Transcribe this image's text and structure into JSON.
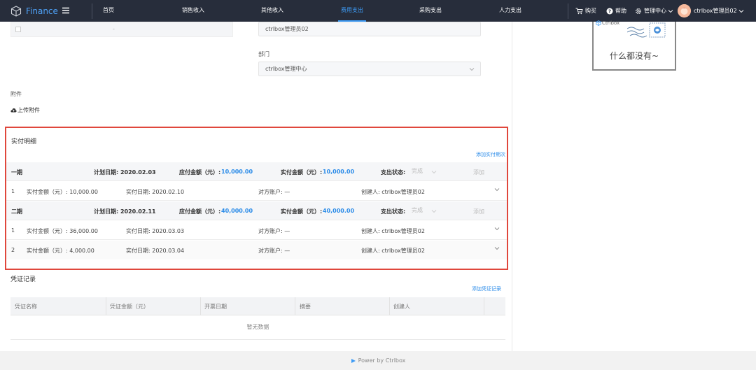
{
  "app": {
    "name": "Finance"
  },
  "nav": {
    "items": [
      {
        "label": "首页"
      },
      {
        "label": "销售收入"
      },
      {
        "label": "其他收入"
      },
      {
        "label": "费用支出"
      },
      {
        "label": "采购支出"
      },
      {
        "label": "人力支出"
      }
    ],
    "active_index": 3
  },
  "topright": {
    "buy": "购买",
    "help": "帮助",
    "admin": "管理中心",
    "user": "ctrlbox管理员02"
  },
  "form": {
    "top_grey_dash": "-",
    "applicant_value": "ctrlbox管理员02",
    "dept_label": "部门",
    "dept_value": "ctrlbox管理中心",
    "attachment_label": "附件",
    "upload_label": "上传附件"
  },
  "payment": {
    "title": "实付明细",
    "add_link": "添加实付期次",
    "periods": [
      {
        "name": "一期",
        "plan_date": "计划日期: 2020.02.03",
        "due_label": "应付金额（元）:",
        "due_value": "10,000.00",
        "paid_label": "实付金额（元）:",
        "paid_value": "10,000.00",
        "status_label": "支出状态:",
        "status_value": "完成",
        "add": "添加",
        "records": [
          {
            "idx": "1",
            "amount": "实付金额（元）: 10,000.00",
            "date": "实付日期: 2020.02.10",
            "account": "对方账户: —",
            "creator": "创建人: ctrlbox管理员02"
          }
        ]
      },
      {
        "name": "二期",
        "plan_date": "计划日期: 2020.02.11",
        "due_label": "应付金额（元）:",
        "due_value": "40,000.00",
        "paid_label": "实付金额（元）:",
        "paid_value": "40,000.00",
        "status_label": "支出状态:",
        "status_value": "完成",
        "add": "添加",
        "records": [
          {
            "idx": "1",
            "amount": "实付金额（元）: 36,000.00",
            "date": "实付日期: 2020.03.03",
            "account": "对方账户: —",
            "creator": "创建人: ctrlbox管理员02"
          },
          {
            "idx": "2",
            "amount": "实付金额（元）: 4,000.00",
            "date": "实付日期: 2020.03.04",
            "account": "对方账户: —",
            "creator": "创建人: ctrlbox管理员02"
          }
        ]
      }
    ]
  },
  "voucher": {
    "title": "凭证记录",
    "add_link": "添加凭证记录",
    "columns": [
      "凭证名称",
      "凭证金额（元）",
      "开票日期",
      "摘要",
      "创建人"
    ],
    "empty": "暂无数据"
  },
  "side": {
    "brand": "Ctrlbox",
    "empty_text": "什么都没有~"
  },
  "footer": {
    "text": "Power by Ctrlbox"
  },
  "colors": {
    "topbar": "#272d3b",
    "accent": "#2a8be8",
    "highlight_border": "#e0473c"
  }
}
